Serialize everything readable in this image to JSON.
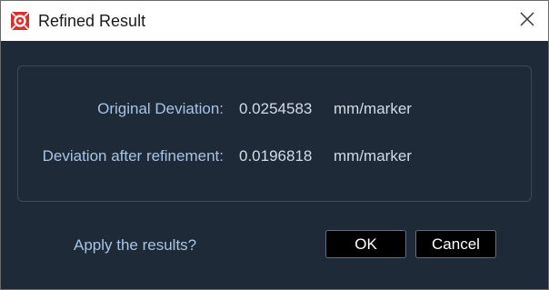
{
  "window": {
    "title": "Refined Result",
    "app_icon": "app-logo-icon",
    "close_icon": "close-icon"
  },
  "results": {
    "original": {
      "label": "Original Deviation:",
      "value": "0.0254583",
      "unit": "mm/marker"
    },
    "refined": {
      "label": "Deviation after refinement:",
      "value": "0.0196818",
      "unit": "mm/marker"
    }
  },
  "prompt": {
    "question": "Apply the results?",
    "ok_label": "OK",
    "cancel_label": "Cancel"
  },
  "colors": {
    "background": "#1e2a38",
    "label": "#a9c3e3",
    "brand": "#d9302c"
  }
}
